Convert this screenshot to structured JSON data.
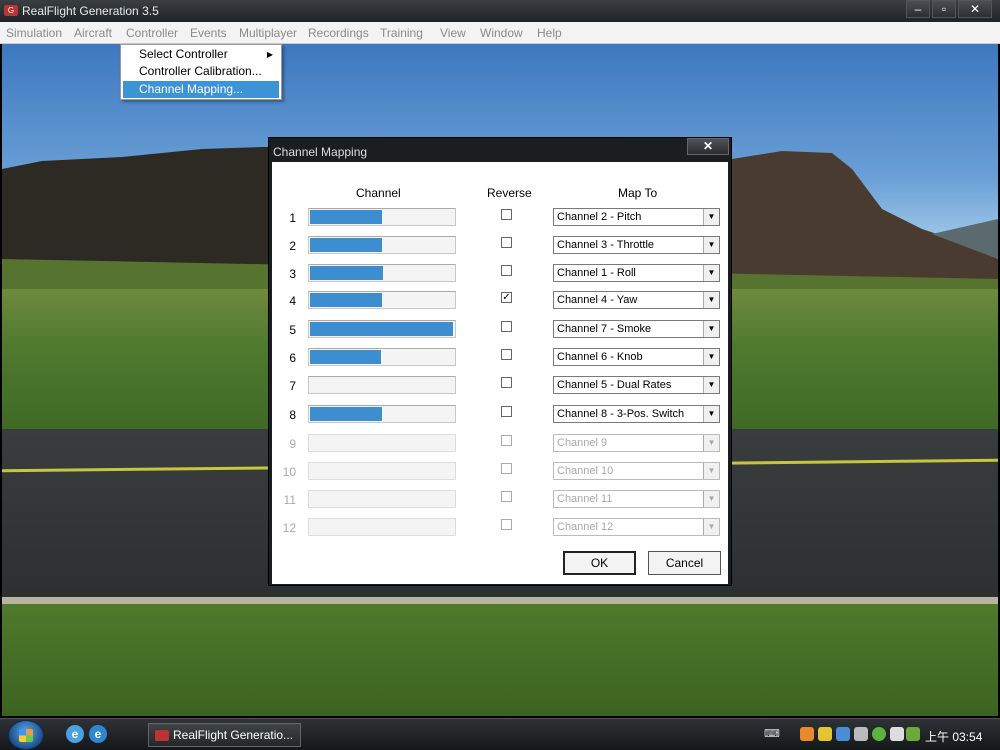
{
  "window": {
    "title": "RealFlight Generation 3.5",
    "icon": "rf-app-icon",
    "controls": {
      "minimize": "–",
      "maximize": "▫",
      "close": "✕"
    }
  },
  "menubar": {
    "items": [
      "Simulation",
      "Aircraft",
      "Controller",
      "Events",
      "Multiplayer",
      "Recordings",
      "Training",
      "View",
      "Window",
      "Help"
    ]
  },
  "controller_menu": {
    "items": [
      {
        "label": "Select Controller",
        "submenu": true
      },
      {
        "label": "Controller Calibration...",
        "submenu": false
      },
      {
        "label": "Channel Mapping...",
        "submenu": false,
        "highlighted": true
      }
    ]
  },
  "dialog": {
    "title": "Channel Mapping",
    "close_label": "✕",
    "headers": {
      "channel": "Channel",
      "reverse": "Reverse",
      "map_to": "Map To"
    },
    "rows": [
      {
        "num": "1",
        "level": 0.5,
        "reverse": false,
        "map": "Channel 2 - Pitch",
        "enabled": true
      },
      {
        "num": "2",
        "level": 0.5,
        "reverse": false,
        "map": "Channel 3 - Throttle",
        "enabled": true
      },
      {
        "num": "3",
        "level": 0.51,
        "reverse": false,
        "map": "Channel 1 - Roll",
        "enabled": true
      },
      {
        "num": "4",
        "level": 0.5,
        "reverse": true,
        "map": "Channel 4 - Yaw",
        "enabled": true
      },
      {
        "num": "5",
        "level": 0.99,
        "reverse": false,
        "map": "Channel 7 - Smoke",
        "enabled": true
      },
      {
        "num": "6",
        "level": 0.49,
        "reverse": false,
        "map": "Channel 6 - Knob",
        "enabled": true
      },
      {
        "num": "7",
        "level": 0,
        "reverse": false,
        "map": "Channel 5 - Dual Rates",
        "enabled": true
      },
      {
        "num": "8",
        "level": 0.5,
        "reverse": false,
        "map": "Channel 8 - 3-Pos. Switch",
        "enabled": true
      },
      {
        "num": "9",
        "level": 0,
        "reverse": false,
        "map": "Channel 9",
        "enabled": false
      },
      {
        "num": "10",
        "level": 0,
        "reverse": false,
        "map": "Channel 10",
        "enabled": false
      },
      {
        "num": "11",
        "level": 0,
        "reverse": false,
        "map": "Channel 11",
        "enabled": false
      },
      {
        "num": "12",
        "level": 0,
        "reverse": false,
        "map": "Channel 12",
        "enabled": false
      }
    ],
    "ok_label": "OK",
    "cancel_label": "Cancel",
    "accent": "#3d8ed0"
  },
  "taskbar": {
    "start_icon": "windows-start-orb",
    "quicklaunch": [
      "internet-explorer-icon",
      "ie-alt-icon"
    ],
    "task_label": "RealFlight Generatio...",
    "ime": "⌨",
    "clock": "上午 03:54"
  }
}
